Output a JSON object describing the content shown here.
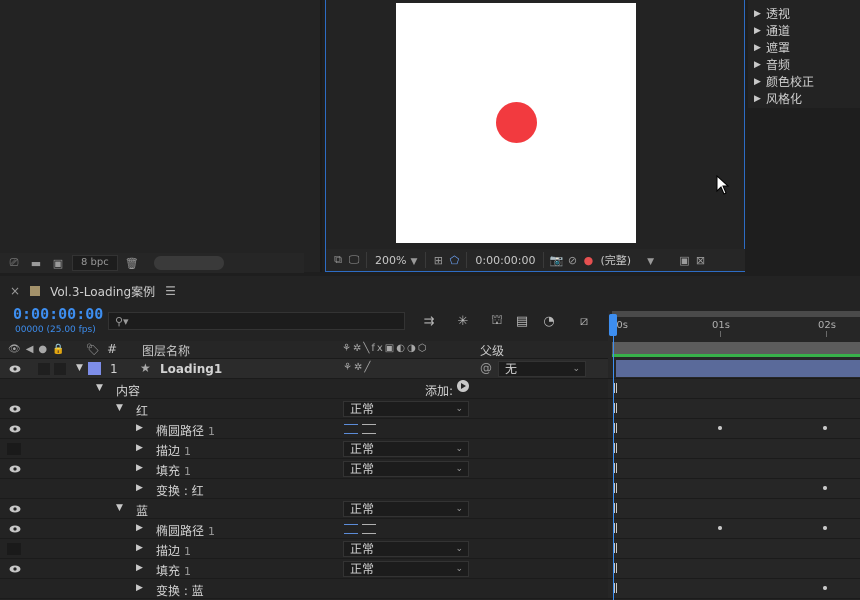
{
  "project": {
    "bpc_label": "8 bpc"
  },
  "viewer": {
    "zoom": "200%",
    "timecode": "0:00:00:00",
    "resolution": "(完整)",
    "dot_color": "#f23a3f"
  },
  "effects": {
    "items": [
      "透视",
      "通道",
      "遮罩",
      "音频",
      "颜色校正",
      "风格化"
    ]
  },
  "timeline": {
    "tab_title": "Vol.3-Loading案例",
    "timecode": "0:00:00:00",
    "fps": "00000 (25.00 fps)",
    "search_placeholder": "",
    "ruler": [
      "00s",
      "01s",
      "02s"
    ],
    "header": {
      "num": "#",
      "name": "图层名称",
      "parent": "父级"
    },
    "layer": {
      "index": "1",
      "name": "Loading1",
      "parent": "无",
      "color": "#7d8de8"
    },
    "add_label": "添加:",
    "rows": [
      {
        "label": "内容",
        "idx": ""
      },
      {
        "label": "红",
        "idx": "",
        "mode": "正常"
      },
      {
        "label": "椭圆路径",
        "idx": "1"
      },
      {
        "label": "描边",
        "idx": "1",
        "mode": "正常"
      },
      {
        "label": "填充",
        "idx": "1",
        "mode": "正常"
      },
      {
        "label": "变换 : 红",
        "idx": ""
      },
      {
        "label": "蓝",
        "idx": "",
        "mode": "正常"
      },
      {
        "label": "椭圆路径",
        "idx": "1"
      },
      {
        "label": "描边",
        "idx": "1",
        "mode": "正常"
      },
      {
        "label": "填充",
        "idx": "1",
        "mode": "正常"
      },
      {
        "label": "变换 : 蓝",
        "idx": ""
      }
    ]
  }
}
